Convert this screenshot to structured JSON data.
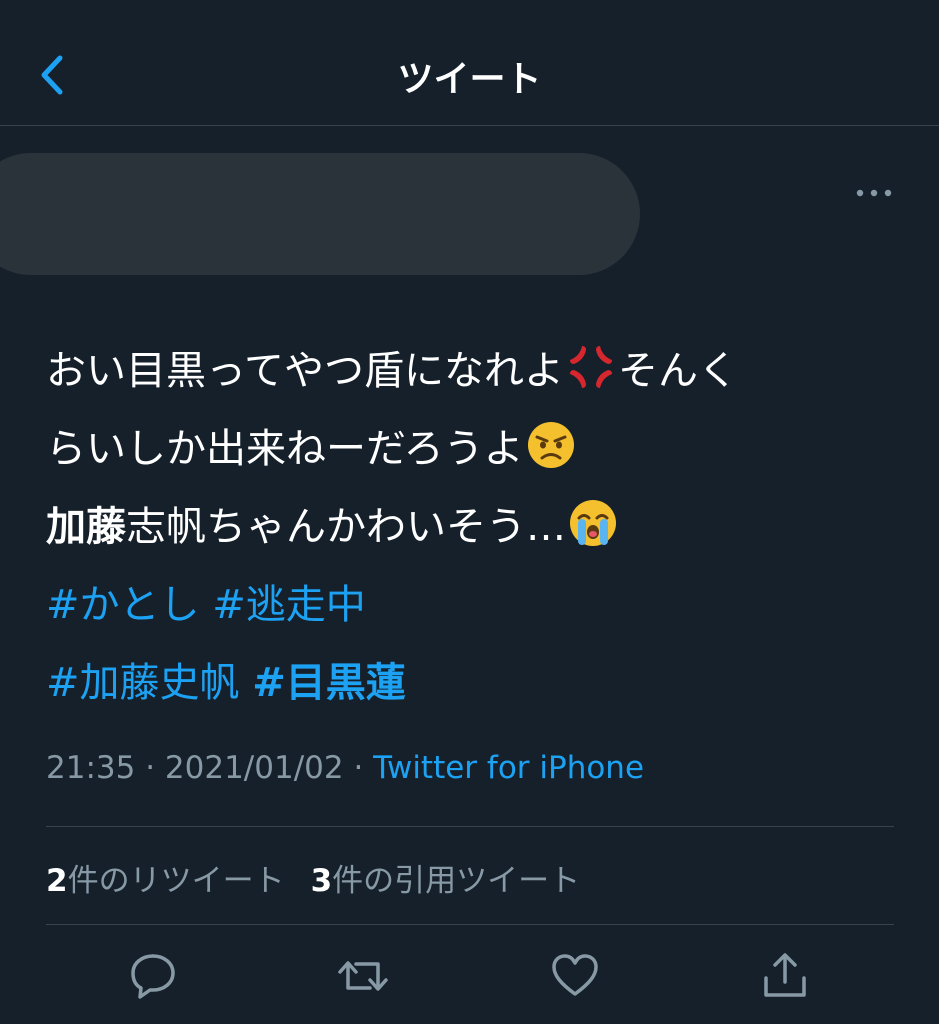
{
  "header": {
    "title": "ツイート",
    "back_icon": "chevron-left-icon"
  },
  "author": {
    "more_icon": "more-horizontal-icon"
  },
  "tweet": {
    "line1_text": "おい目黒ってやつ盾になれよ",
    "line1_emoji": "anger-symbol-icon",
    "line1_tail": "そんく",
    "line2_text": "らいしか出来ねーだろうよ",
    "line2_emoji": "angry-face-icon",
    "line3_bold": "加藤",
    "line3_text": "志帆ちゃんかわいそう…",
    "line3_emoji": "loudly-crying-face-icon",
    "hashtags_line1": [
      "#かとし",
      "#逃走中"
    ],
    "hashtag_line2_a": "#加藤史帆",
    "hashtag_line2_b": "#目黒蓮"
  },
  "meta": {
    "time": "21:35",
    "sep": " · ",
    "date": "2021/01/02",
    "source": "Twitter for iPhone"
  },
  "stats": {
    "retweets_count": "2",
    "retweets_label": "件のリツイート",
    "quotes_count": "3",
    "quotes_label": "件の引用ツイート"
  },
  "actions": {
    "reply_icon": "reply-icon",
    "retweet_icon": "retweet-icon",
    "like_icon": "heart-icon",
    "share_icon": "share-icon"
  },
  "colors": {
    "background": "#15202b",
    "accent": "#1da1f2",
    "secondary_text": "#8899a6",
    "divider": "#38444d"
  }
}
